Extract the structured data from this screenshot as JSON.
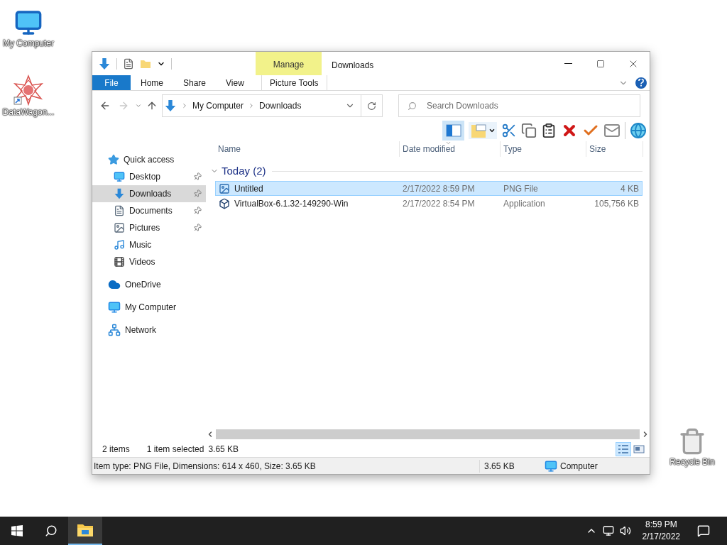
{
  "desktop_icons": [
    {
      "label": "My Computer",
      "kind": "computer"
    },
    {
      "label": "DataWagon...",
      "kind": "shortcut"
    },
    {
      "label": "Recycle Bin",
      "kind": "bin"
    }
  ],
  "window": {
    "title": "Downloads",
    "context_group": "Manage"
  },
  "ribbon_tabs": [
    {
      "label": "File",
      "kind": "file"
    },
    {
      "label": "Home",
      "kind": "normal"
    },
    {
      "label": "Share",
      "kind": "normal"
    },
    {
      "label": "View",
      "kind": "normal"
    },
    {
      "label": "Picture Tools",
      "kind": "context"
    }
  ],
  "address": {
    "path": [
      "My Computer",
      "Downloads"
    ]
  },
  "search": {
    "placeholder": "Search Downloads"
  },
  "sidebar": {
    "items": [
      {
        "label": "Quick access",
        "kind": "star",
        "selected": false,
        "children": [
          {
            "label": "Desktop",
            "kind": "desktop",
            "selected": false,
            "pinned": true
          },
          {
            "label": "Downloads",
            "kind": "downloads",
            "selected": true,
            "pinned": true
          },
          {
            "label": "Documents",
            "kind": "documents",
            "selected": false,
            "pinned": true
          },
          {
            "label": "Pictures",
            "kind": "pictures",
            "selected": false,
            "pinned": true
          },
          {
            "label": "Music",
            "kind": "music",
            "selected": false,
            "pinned": false
          },
          {
            "label": "Videos",
            "kind": "videos",
            "selected": false,
            "pinned": false
          }
        ]
      },
      {
        "label": "OneDrive",
        "kind": "cloud",
        "selected": false
      },
      {
        "label": "My Computer",
        "kind": "computer",
        "selected": false
      },
      {
        "label": "Network",
        "kind": "network",
        "selected": false
      }
    ]
  },
  "table": {
    "columns": [
      {
        "label": "Name",
        "sorted": false
      },
      {
        "label": "Date modified",
        "sorted": true
      },
      {
        "label": "Type",
        "sorted": false
      },
      {
        "label": "Size",
        "sorted": false
      }
    ],
    "groups": [
      {
        "label": "Today (2)",
        "expanded": true,
        "rows": [
          {
            "kind": "image",
            "name": "Untitled",
            "date": "2/17/2022 8:59 PM",
            "type": "PNG File",
            "size": "4 KB",
            "selected": true
          },
          {
            "kind": "app",
            "name": "VirtualBox-6.1.32-149290-Win",
            "date": "2/17/2022 8:54 PM",
            "type": "Application",
            "size": "105,756 KB",
            "selected": false
          }
        ]
      }
    ]
  },
  "status": {
    "count": "2 items",
    "selection": "1 item selected",
    "selection_size": "3.65 KB",
    "views": [
      {
        "kind": "details",
        "selected": true
      },
      {
        "kind": "tiles",
        "selected": false
      }
    ]
  },
  "details_bar": {
    "info": "Item type: PNG File, Dimensions: 614 x 460, Size: 3.65 KB",
    "size": "3.65 KB",
    "location": "Computer"
  },
  "taskbar": {
    "apps": [
      {
        "kind": "explorer",
        "selected": true
      }
    ],
    "time": "8:59 PM",
    "date": "2/17/2022"
  }
}
